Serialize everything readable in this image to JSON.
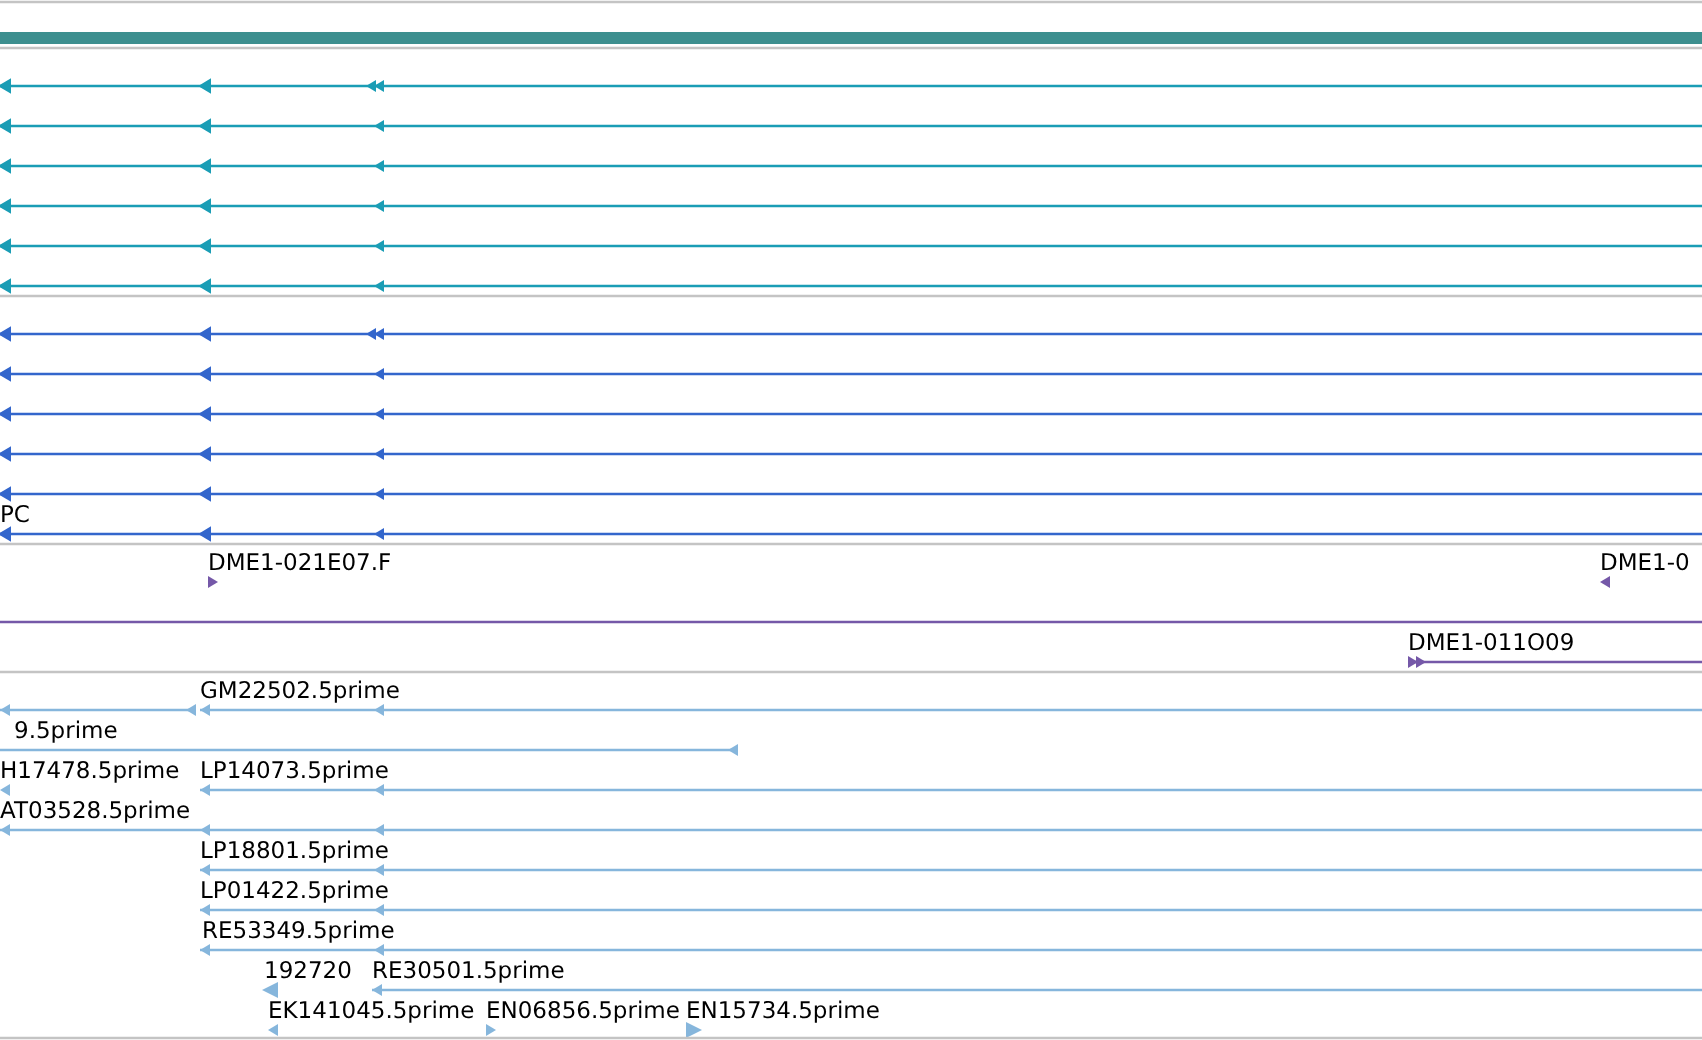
{
  "tracks": [
    {
      "kind": "models",
      "color": "#1a9db5",
      "rows": [
        {
          "split_end": true
        },
        {
          "split_end": false
        },
        {
          "split_end": false
        },
        {
          "split_end": false
        },
        {
          "split_end": false
        },
        {
          "split_end": false
        }
      ]
    },
    {
      "kind": "models",
      "color": "#3366cc",
      "rows": [
        {
          "split_end": true
        },
        {
          "split_end": false
        },
        {
          "split_end": false
        },
        {
          "split_end": false
        },
        {
          "split_end": false
        },
        {
          "split_end": false,
          "label": "PC"
        }
      ]
    },
    {
      "kind": "clones",
      "color": "#7558a8",
      "features": [
        {
          "kind": "arrow",
          "label": "DME1-021E07.F",
          "forward": true
        },
        {
          "kind": "arrow",
          "label": "DME1-0",
          "forward": false
        },
        {
          "kind": "span"
        },
        {
          "kind": "line",
          "label": "DME1-011O09",
          "forward": true
        }
      ]
    },
    {
      "kind": "ests",
      "color": "#86b6dc",
      "features": [
        {
          "kind": "line",
          "label": "GM22502.5prime",
          "forward": false
        },
        {
          "kind": "line",
          "forward": false
        },
        {
          "kind": "line",
          "label": "9.5prime",
          "forward": false
        },
        {
          "kind": "arrow",
          "label": "H17478.5prime",
          "forward": false
        },
        {
          "kind": "line",
          "label": "LP14073.5prime",
          "forward": false
        },
        {
          "kind": "line",
          "label": "AT03528.5prime",
          "forward": false
        },
        {
          "kind": "line",
          "label": "LP18801.5prime",
          "forward": false
        },
        {
          "kind": "line",
          "label": "LP01422.5prime",
          "forward": false
        },
        {
          "kind": "line",
          "label": "RE53349.5prime",
          "forward": false
        },
        {
          "kind": "arrow",
          "label": "192720",
          "forward": false
        },
        {
          "kind": "line",
          "label": "RE30501.5prime",
          "forward": false
        },
        {
          "kind": "arrow",
          "label": "EK141045.5prime",
          "forward": false
        },
        {
          "kind": "arrow",
          "label": "EN06856.5prime",
          "forward": true
        },
        {
          "kind": "arrow",
          "label": "EN15734.5prime",
          "forward": true
        }
      ]
    }
  ]
}
